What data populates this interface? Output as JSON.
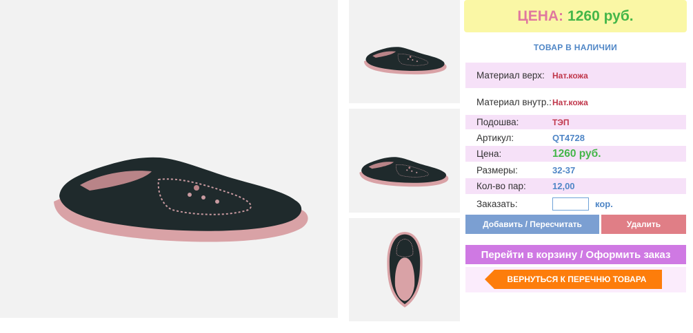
{
  "images": {
    "main": "black suede loafer with pink sole",
    "thumbnails": [
      "side view",
      "angle view",
      "top view"
    ]
  },
  "price_box": {
    "label": "ЦЕНА:",
    "value": "1260 руб."
  },
  "stock_status": "ТОВАР В НАЛИЧИИ",
  "properties": [
    {
      "label": "Материал верх:",
      "value": "Нат.кожа"
    },
    {
      "label": "Материал внутр.:",
      "value": "Нат.кожа"
    },
    {
      "label": "Подошва:",
      "value": "ТЭП"
    },
    {
      "label": "Артикул:",
      "value": "QT4728"
    },
    {
      "label": "Цена:",
      "value": "1260 руб."
    },
    {
      "label": "Размеры:",
      "value": "32-37"
    },
    {
      "label": "Кол-во пар:",
      "value": "12,00"
    }
  ],
  "order": {
    "label": "Заказать:",
    "value": "",
    "unit": "кор."
  },
  "buttons": {
    "add": "Добавить / Пересчитать",
    "delete": "Удалить",
    "cart": "Перейти в корзину / Оформить заказ",
    "back": "ВЕРНУТЬСЯ К ПЕРЕЧНЮ ТОВАРА"
  },
  "colors": {
    "price_label": "#e0779f",
    "price_value": "#44b649",
    "accent_blue": "#4f86c6",
    "back_button": "#fd7d0b"
  }
}
